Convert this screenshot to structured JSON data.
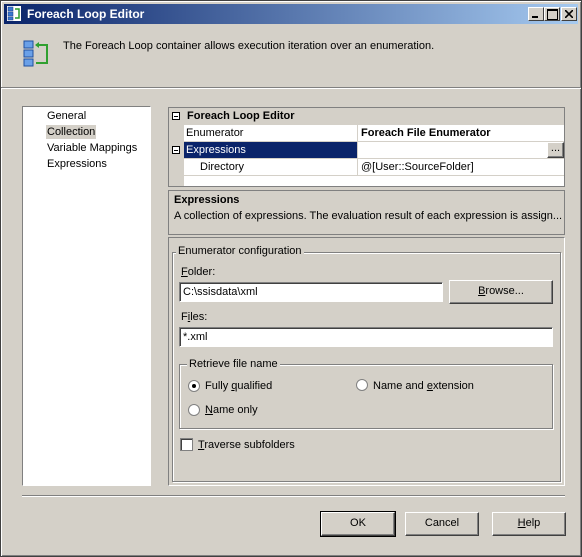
{
  "window": {
    "title": "Foreach Loop Editor"
  },
  "header": {
    "description": "The Foreach Loop container allows execution iteration over an enumeration."
  },
  "nav": {
    "items": [
      "General",
      "Collection",
      "Variable Mappings",
      "Expressions"
    ],
    "selected": "Collection"
  },
  "grid": {
    "category": "Foreach Loop Editor",
    "rows": [
      {
        "name": "Enumerator",
        "value": "Foreach File Enumerator"
      },
      {
        "name": "Expressions",
        "value": ""
      },
      {
        "name": "Directory",
        "value": "@[User::SourceFolder]"
      }
    ],
    "ellipsis": "..."
  },
  "description_panel": {
    "title": "Expressions",
    "text": "A collection of expressions. The evaluation result of each expression is assign..."
  },
  "config": {
    "legend": "Enumerator configuration",
    "folder_label": "Folder:",
    "folder_value": "C:\\ssisdata\\xml",
    "browse_label": "Browse...",
    "files_label": "Files:",
    "files_value": "*.xml",
    "retrieve_legend": "Retrieve file name",
    "opt_fully_qualified": "Fully qualified",
    "opt_name_and_extension": "Name and extension",
    "opt_name_only": "Name only",
    "traverse_label": "Traverse subfolders"
  },
  "buttons": {
    "ok": "OK",
    "cancel": "Cancel",
    "help": "Help"
  },
  "colors": {
    "title_start": "#0a246a",
    "title_end": "#a6caf0",
    "selection": "#0a246a",
    "face": "#d4d0c8"
  }
}
